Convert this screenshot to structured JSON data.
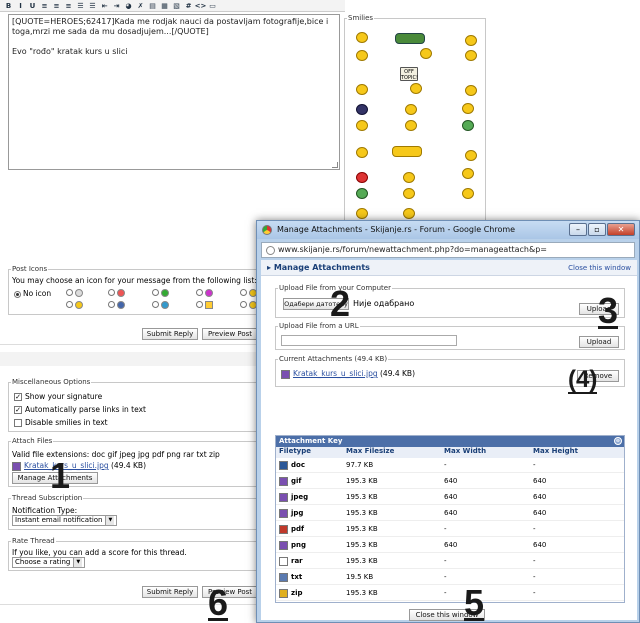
{
  "toolbar": {
    "buttons": [
      "B",
      "I",
      "U",
      "≡",
      "≡",
      "≡",
      "☰",
      "☰",
      "⇤",
      "⇥",
      "◕",
      "✗",
      "▤",
      "▦",
      "▧",
      "#",
      "<>",
      "▭"
    ]
  },
  "editor": {
    "text": "[QUOTE=HEROES;62417]Kada me rodjak nauci da postavljam fotografije,bice i toga,mrzi me sada da mu dosadjujem...[/QUOTE]\n\nEvo \"rođo\" kratak kurs u slici"
  },
  "smilies": {
    "legend": "Smilies",
    "topic_sign": "OFF TOPIC!"
  },
  "post_icons": {
    "legend": "Post Icons",
    "prompt": "You may choose an icon for your message from the following list:",
    "no_icon": "No icon"
  },
  "buttons": {
    "submit_reply": "Submit Reply",
    "preview_post": "Preview Post",
    "preview_post_short": "Preview Post"
  },
  "misc": {
    "legend": "Miscellaneous Options",
    "opt1": "Show your signature",
    "opt2": "Automatically parse links in text",
    "opt3": "Disable smilies in text"
  },
  "attach": {
    "legend": "Attach Files",
    "extensions": "Valid file extensions: doc gif jpeg jpg pdf png rar txt zip",
    "file_link": "Kratak_kurs_u_slici.jpg",
    "file_size": "(49.4 KB)",
    "manage_button": "Manage Attachments"
  },
  "subscription": {
    "legend": "Thread Subscription",
    "label": "Notification Type:",
    "value": "Instant email notification"
  },
  "rate": {
    "legend": "Rate Thread",
    "text": "If you like, you can add a score for this thread.",
    "value": "Choose a rating"
  },
  "popup": {
    "title": "Manage Attachments - Skijanje.rs - Forum - Google Chrome",
    "url": "www.skijanje.rs/forum/newattachment.php?do=manageattach&p=",
    "heading": "Manage Attachments",
    "close_link": "Close this window",
    "upload_computer_legend": "Upload File from your Computer",
    "choose_button": "Одабери датотеку",
    "no_file": "Није одабрано",
    "upload_button": "Upload",
    "upload_url_legend": "Upload File from a URL",
    "upload_button2": "Upload",
    "current_legend": "Current Attachments (49.4 KB)",
    "current_file": "Kratak_kurs_u_slici.jpg",
    "current_size": "(49.4 KB)",
    "remove_button": "Remove",
    "key_title": "Attachment Key",
    "columns": [
      "Filetype",
      "Max Filesize",
      "Max Width",
      "Max Height"
    ],
    "rows": [
      {
        "type": "doc",
        "size": "97.7 KB",
        "w": "-",
        "h": "-",
        "color": "#2b5797"
      },
      {
        "type": "gif",
        "size": "195.3 KB",
        "w": "640",
        "h": "640",
        "color": "#7a4fb0"
      },
      {
        "type": "jpeg",
        "size": "195.3 KB",
        "w": "640",
        "h": "640",
        "color": "#7a4fb0"
      },
      {
        "type": "jpg",
        "size": "195.3 KB",
        "w": "640",
        "h": "640",
        "color": "#7a4fb0"
      },
      {
        "type": "pdf",
        "size": "195.3 KB",
        "w": "-",
        "h": "-",
        "color": "#c0392b"
      },
      {
        "type": "png",
        "size": "195.3 KB",
        "w": "640",
        "h": "640",
        "color": "#7a4fb0"
      },
      {
        "type": "rar",
        "size": "195.3 KB",
        "w": "-",
        "h": "-",
        "color": "#ffffff"
      },
      {
        "type": "txt",
        "size": "19.5 KB",
        "w": "-",
        "h": "-",
        "color": "#5a7ab0"
      },
      {
        "type": "zip",
        "size": "195.3 KB",
        "w": "-",
        "h": "-",
        "color": "#e0b020"
      }
    ],
    "close_button": "Close this window"
  },
  "annotations": [
    "1",
    "2",
    "3",
    "(4)",
    "5",
    "6"
  ]
}
